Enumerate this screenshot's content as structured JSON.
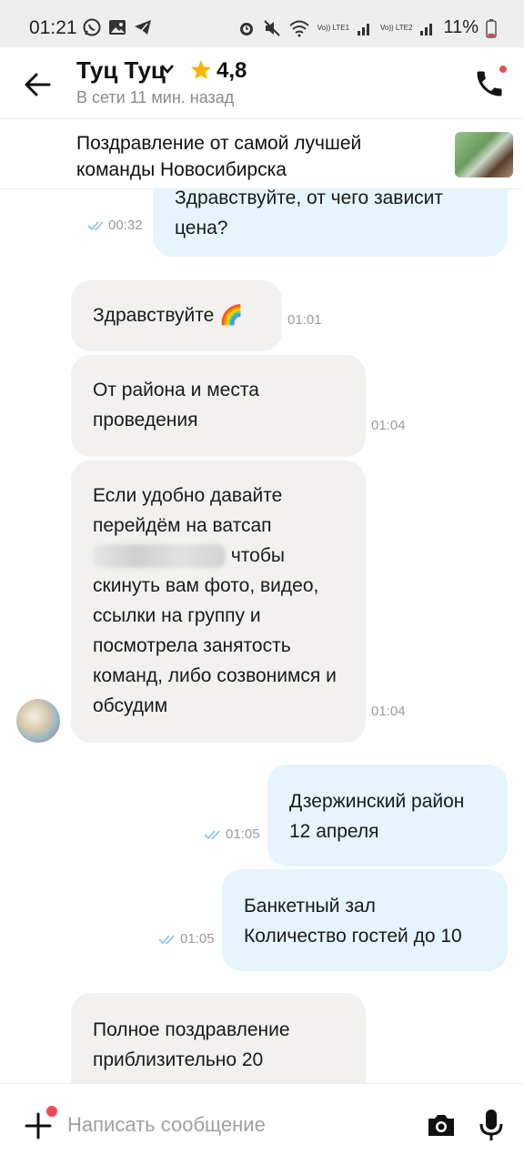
{
  "status_bar": {
    "time": "01:21",
    "battery": "11%",
    "icons": [
      "whatsapp-icon",
      "gallery-icon",
      "telegram-icon",
      "alarm-icon",
      "mute-icon",
      "wifi-icon",
      "signal-icon",
      "signal-icon",
      "battery-icon"
    ],
    "signal_labels": [
      "Vo)) LTE1",
      "Vo)) LTE2"
    ]
  },
  "header": {
    "name": "Туц Туц",
    "rating": "4,8",
    "online_status": "В сети 11 мин. назад",
    "colors": {
      "star": "#f7b500",
      "dot": "#f04b55"
    }
  },
  "ad": {
    "title": "Поздравление от самой лучшей команды Новосибирска"
  },
  "messages": [
    {
      "dir": "out",
      "text": "Здравствуйте, от чего зависит цена?",
      "time": "00:32",
      "read": true
    },
    {
      "dir": "in",
      "text": "Здравствуйте 🌈",
      "time": "01:01"
    },
    {
      "dir": "in",
      "text": "От района и места проведения",
      "time": "01:04"
    },
    {
      "dir": "in",
      "text_parts": [
        "Если удобно давайте перейдём на ватсап",
        "чтобы скинуть вам фото, видео, ссылки на группу и посмотрела занятость команд, либо созвонимся и обсудим"
      ],
      "time": "01:04"
    },
    {
      "dir": "out",
      "text_lines": [
        "Дзержинский район",
        "12 апреля"
      ],
      "time": "01:05",
      "read": true
    },
    {
      "dir": "out",
      "text_lines": [
        "Банкетный зал",
        "Количество гостей до 10"
      ],
      "time": "01:05",
      "read": true
    },
    {
      "dir": "in",
      "text": "Полное поздравление приблизительно 20"
    }
  ],
  "input": {
    "placeholder": "Написать сообщение"
  },
  "colors": {
    "incoming_bubble": "#f2f1ef",
    "outgoing_bubble": "#e5f4fd",
    "read_ticks": "#7fc3ea"
  }
}
